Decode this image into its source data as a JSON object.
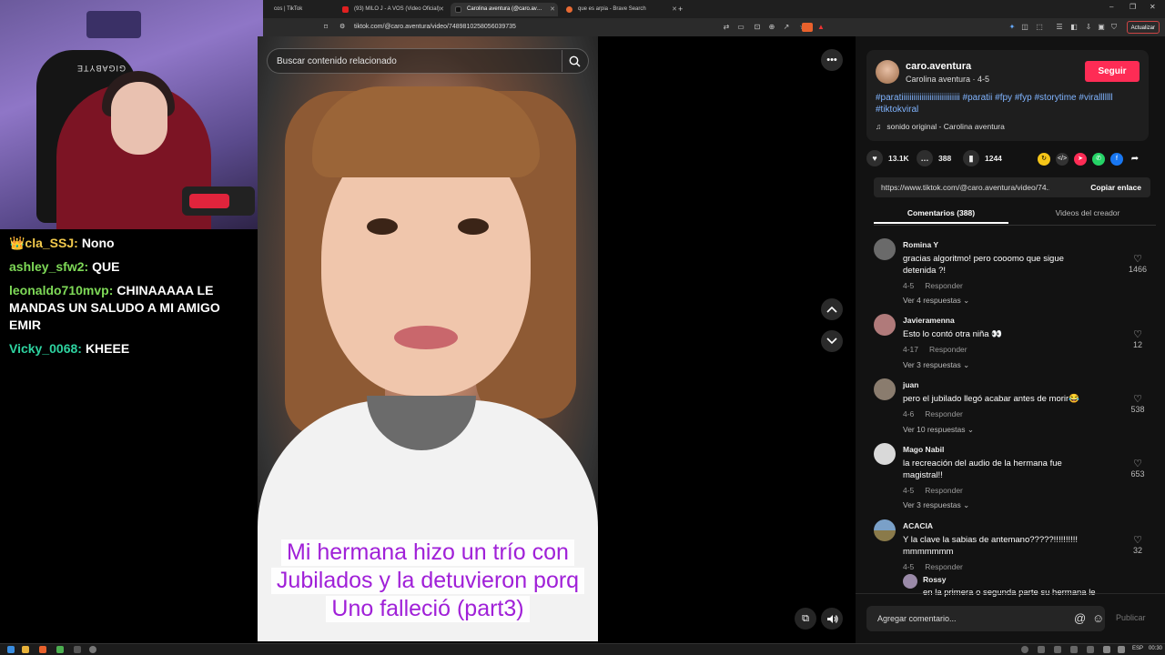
{
  "stream": {
    "chair_brand": "GIGABYTE",
    "chat": [
      {
        "user": "👑cla_SSJ:",
        "msg": "Nono",
        "color": "#f2c94c"
      },
      {
        "user": "ashley_sfw2:",
        "msg": "QUE",
        "color": "#7ed957"
      },
      {
        "user": "leonaldo710mvp:",
        "msg": "CHINAAAAA LE MANDAS UN SALUDO A MI AMIGO EMIR",
        "color": "#7ed957"
      },
      {
        "user": "Vicky_0068:",
        "msg": "KHEEE",
        "color": "#2ed3a0"
      }
    ]
  },
  "browser": {
    "tabs": [
      {
        "label": "cos | TikTok"
      },
      {
        "label": "(93) MILO J - A VOS (Video Oficial)"
      },
      {
        "label": "Carolina aventura (@caro.av…"
      },
      {
        "label": "que es arpia - Brave Search"
      }
    ],
    "new_tab": "+",
    "url": "tiktok.com/@caro.aventura/video/7489810258056039735",
    "update_label": "Actualizar"
  },
  "video": {
    "search_placeholder": "Buscar contenido relacionado",
    "caption_lines": [
      "Mi hermana hizo un trío con",
      "Jubilados y la detuvieron porq",
      "Uno falleció (part3)"
    ]
  },
  "creator": {
    "handle": "caro.aventura",
    "subtitle": "Carolina aventura · 4-5",
    "follow_label": "Seguir",
    "description": "#paratiiiiiiiiiiiiiiiiiiiiiiiiiiiii #paratii #fpy #fyp #storytime #viralllllll #tiktokviral",
    "sound": "sonido original - Carolina aventura"
  },
  "stats": {
    "likes": "13.1K",
    "comments": "388",
    "saves": "1244"
  },
  "link": {
    "url": "https://www.tiktok.com/@caro.aventura/video/74...",
    "copy_label": "Copiar enlace"
  },
  "comment_tabs": {
    "comments": "Comentarios (388)",
    "videos": "Videos del creador"
  },
  "comments": [
    {
      "user": "Romina Y",
      "text": "gracias algoritmo! pero cooomo que sigue detenida ?!",
      "date": "4-5",
      "reply": "Responder",
      "more": "Ver 4 respuestas ⌄",
      "likes": "1466",
      "avatar": "#6a6a6a"
    },
    {
      "user": "Javieramenna",
      "text": "Esto lo contó otra niña 👀",
      "date": "4-17",
      "reply": "Responder",
      "more": "Ver 3 respuestas ⌄",
      "likes": "12",
      "avatar": "#b07a7a"
    },
    {
      "user": "juan",
      "text": "pero el jubilado llegó acabar antes de morir😂",
      "date": "4-6",
      "reply": "Responder",
      "more": "Ver 10 respuestas ⌄",
      "likes": "538",
      "avatar": "#8a7c6e"
    },
    {
      "user": "Mago Nabil",
      "text": "la recreación del audio de la hermana fue magistral!!",
      "date": "4-5",
      "reply": "Responder",
      "more": "Ver 3 respuestas ⌄",
      "likes": "653",
      "avatar": "#d9d9d9"
    },
    {
      "user": "ACACIA",
      "text": "Y la clave la sabias de antemano?????!!!!!!!!!! mmmmmmm",
      "date": "4-5",
      "reply": "Responder",
      "more": "",
      "likes": "32",
      "avatar": "#7aa0c8"
    },
    {
      "user": "Rossy",
      "text": "en la primera o segunda parte su hermana le",
      "date": "",
      "reply": "",
      "more": "",
      "likes": "",
      "avatar": "#9a8aa8"
    }
  ],
  "comment_input": {
    "placeholder": "Agregar comentario...",
    "post_label": "Publicar"
  },
  "taskbar": {
    "lang": "ESP",
    "time": "00:30"
  }
}
